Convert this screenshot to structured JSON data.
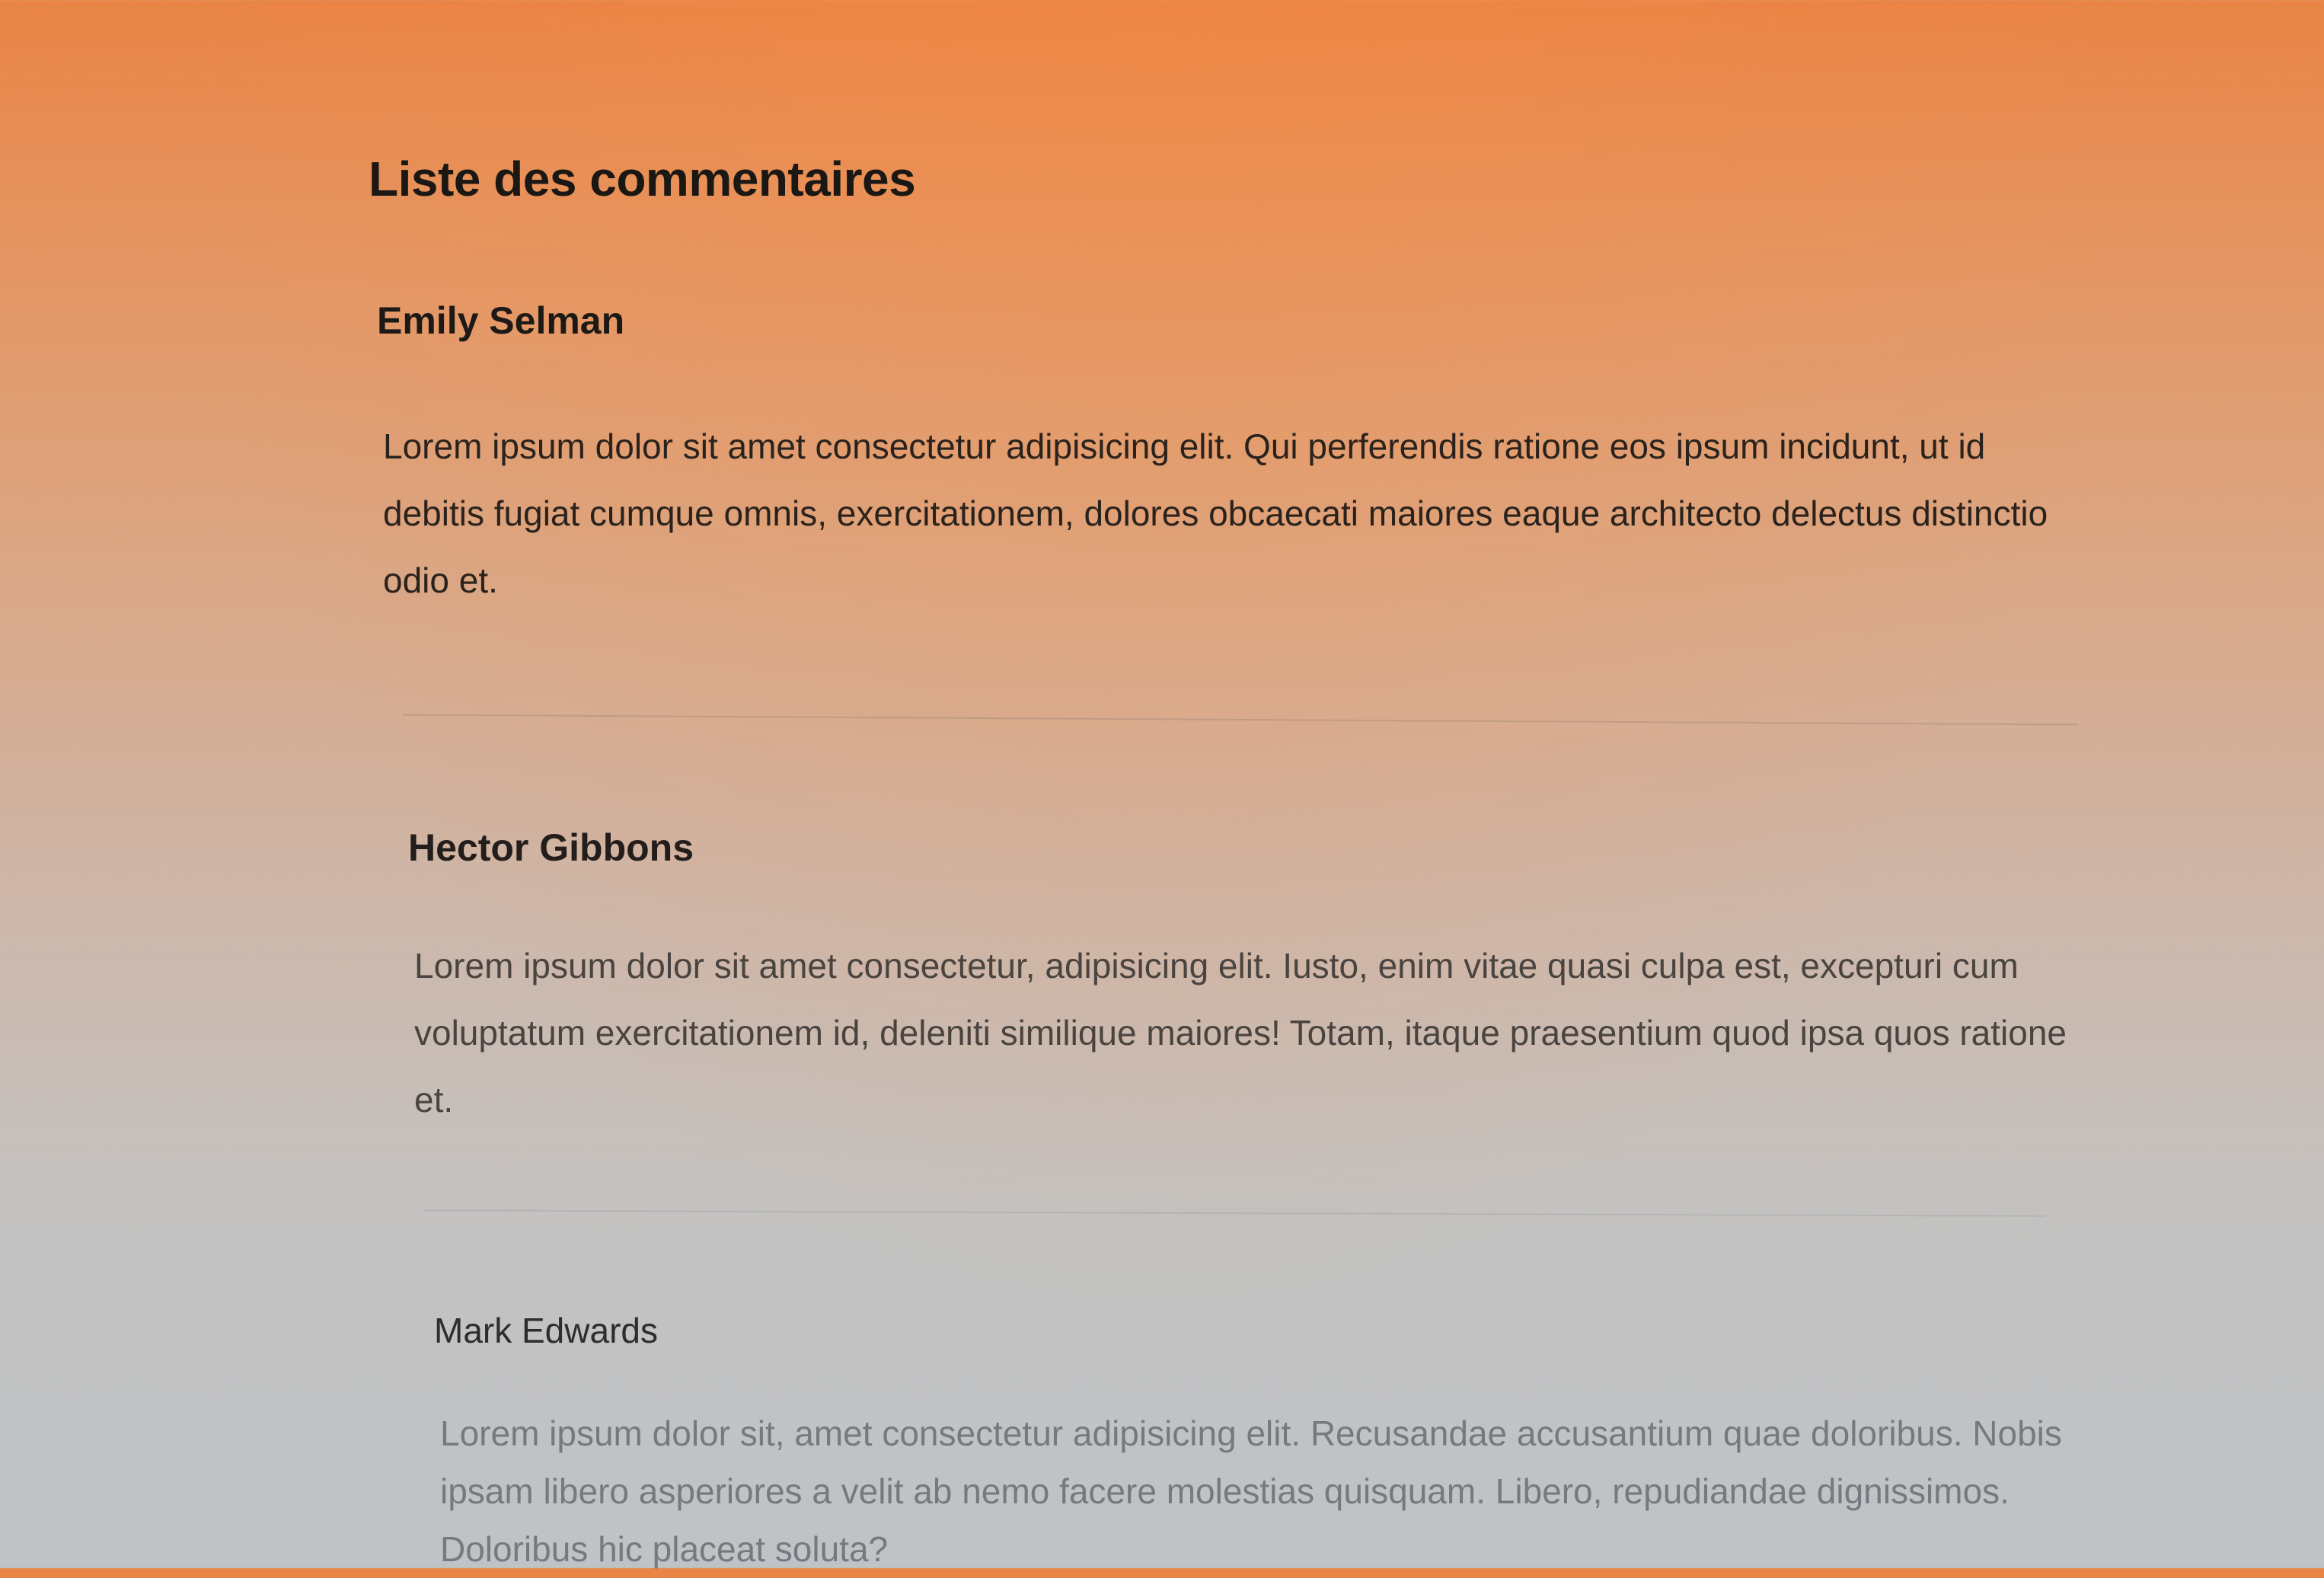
{
  "page": {
    "title": "Liste des commentaires"
  },
  "comments": [
    {
      "author": "Emily Selman",
      "text": "Lorem ipsum dolor sit amet consectetur adipisicing elit. Qui perferendis ratione eos ipsum incidunt, ut id debitis fugiat cumque omnis, exercitationem, dolores obcaecati maiores eaque architecto delectus distinctio odio et."
    },
    {
      "author": "Hector Gibbons",
      "text": "Lorem ipsum dolor sit amet consectetur, adipisicing elit. Iusto, enim vitae quasi culpa est, excepturi cum voluptatum exercitationem id, deleniti similique maiores! Totam, itaque praesentium quod ipsa quos ratione et."
    },
    {
      "author": "Mark Edwards",
      "text": "Lorem ipsum dolor sit, amet consectetur adipisicing elit. Recusandae accusantium quae doloribus. Nobis ipsam libero asperiores a velit ab nemo facere molestias quisquam. Libero, repudiandae dignissimos. Doloribus hic placeat soluta?"
    }
  ]
}
